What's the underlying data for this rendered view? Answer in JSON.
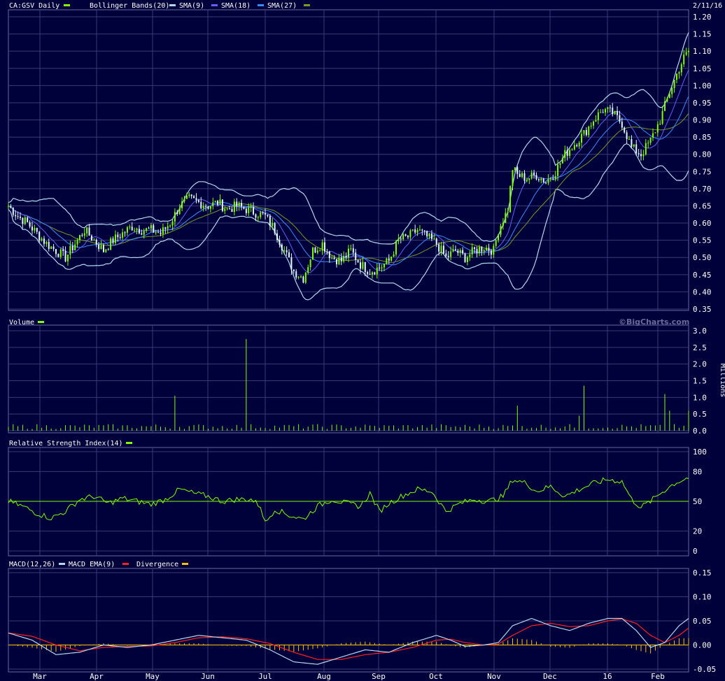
{
  "header": {
    "symbol_label": "CA:GSV Daily",
    "date_label": "2/11/16",
    "watermark": "©BigCharts.com",
    "millions_label": "Millions"
  },
  "legend": {
    "price": [
      {
        "label": "CA:GSV Daily",
        "color": "#7fff00"
      },
      {
        "label": "Bollinger Bands(20)",
        "color": "#b0d8f0"
      },
      {
        "label": "SMA(9)",
        "color": "#6060ff"
      },
      {
        "label": "SMA(18)",
        "color": "#3a8cff"
      },
      {
        "label": "SMA(27)",
        "color": "#7a9a20"
      }
    ],
    "volume": [
      {
        "label": "Volume",
        "color": "#7fff00"
      }
    ],
    "rsi": [
      {
        "label": "Relative Strength Index(14)",
        "color": "#7fff00"
      }
    ],
    "macd": [
      {
        "label": "MACD(12,26)",
        "color": "#b0d8f0"
      },
      {
        "label": "MACD EMA(9)",
        "color": "#ff2020"
      },
      {
        "label": "Divergence",
        "color": "#ffc000"
      }
    ]
  },
  "chart_data": [
    {
      "type": "line",
      "name": "price",
      "x_labels": [
        "Mar",
        "Apr",
        "May",
        "Jun",
        "Jul",
        "Aug",
        "Sep",
        "Oct",
        "Nov",
        "Dec",
        "16",
        "Feb"
      ],
      "ylim": [
        0.35,
        1.2
      ],
      "yticks": [
        "0.35",
        "0.40",
        "0.45",
        "0.50",
        "0.55",
        "0.60",
        "0.65",
        "0.70",
        "0.75",
        "0.80",
        "0.85",
        "0.90",
        "0.95",
        "1.00",
        "1.05",
        "1.10",
        "1.15",
        "1.20"
      ],
      "close_points": [
        [
          0,
          0.65
        ],
        [
          4,
          0.62
        ],
        [
          8,
          0.6
        ],
        [
          12,
          0.57
        ],
        [
          16,
          0.54
        ],
        [
          20,
          0.52
        ],
        [
          24,
          0.5
        ],
        [
          28,
          0.54
        ],
        [
          32,
          0.58
        ],
        [
          36,
          0.55
        ],
        [
          40,
          0.52
        ],
        [
          44,
          0.55
        ],
        [
          48,
          0.57
        ],
        [
          52,
          0.59
        ],
        [
          56,
          0.58
        ],
        [
          60,
          0.58
        ],
        [
          64,
          0.57
        ],
        [
          68,
          0.6
        ],
        [
          72,
          0.65
        ],
        [
          76,
          0.67
        ],
        [
          80,
          0.66
        ],
        [
          84,
          0.65
        ],
        [
          88,
          0.66
        ],
        [
          92,
          0.64
        ],
        [
          96,
          0.65
        ],
        [
          100,
          0.64
        ],
        [
          104,
          0.63
        ],
        [
          108,
          0.62
        ],
        [
          112,
          0.58
        ],
        [
          116,
          0.52
        ],
        [
          120,
          0.46
        ],
        [
          124,
          0.44
        ],
        [
          128,
          0.52
        ],
        [
          132,
          0.54
        ],
        [
          136,
          0.5
        ],
        [
          140,
          0.49
        ],
        [
          144,
          0.52
        ],
        [
          148,
          0.48
        ],
        [
          152,
          0.46
        ],
        [
          156,
          0.47
        ],
        [
          160,
          0.49
        ],
        [
          164,
          0.55
        ],
        [
          168,
          0.56
        ],
        [
          172,
          0.58
        ],
        [
          176,
          0.56
        ],
        [
          180,
          0.54
        ],
        [
          184,
          0.5
        ],
        [
          188,
          0.52
        ],
        [
          192,
          0.5
        ],
        [
          196,
          0.52
        ],
        [
          200,
          0.53
        ],
        [
          204,
          0.52
        ],
        [
          206,
          0.58
        ],
        [
          210,
          0.64
        ],
        [
          212,
          0.76
        ],
        [
          214,
          0.74
        ],
        [
          218,
          0.73
        ],
        [
          222,
          0.74
        ],
        [
          226,
          0.72
        ],
        [
          230,
          0.75
        ],
        [
          234,
          0.8
        ],
        [
          238,
          0.83
        ],
        [
          242,
          0.86
        ],
        [
          246,
          0.9
        ],
        [
          250,
          0.93
        ],
        [
          254,
          0.92
        ],
        [
          258,
          0.89
        ],
        [
          262,
          0.82
        ],
        [
          266,
          0.8
        ],
        [
          270,
          0.84
        ],
        [
          274,
          0.9
        ],
        [
          278,
          0.98
        ],
        [
          282,
          1.05
        ],
        [
          284,
          1.08
        ],
        [
          286,
          1.1
        ]
      ],
      "volume_label": "Volume",
      "volume_unit": "Millions",
      "volume_ylim": [
        0,
        3.0
      ],
      "volume_yticks": [
        "0.0",
        "0.5",
        "1.0",
        "1.5",
        "2.0",
        "2.5",
        "3.0"
      ],
      "volume_spikes": [
        [
          70,
          1.05
        ],
        [
          100,
          2.75
        ],
        [
          215,
          0.75
        ],
        [
          240,
          0.45
        ],
        [
          243,
          1.35
        ],
        [
          276,
          1.1
        ],
        [
          279,
          0.6
        ],
        [
          286,
          0.6
        ]
      ],
      "rsi_ylim": [
        0,
        100
      ],
      "rsi_yticks": [
        "0",
        "20",
        "50",
        "80",
        "100"
      ],
      "rsi_points": [
        [
          0,
          50
        ],
        [
          6,
          45
        ],
        [
          12,
          38
        ],
        [
          18,
          33
        ],
        [
          24,
          40
        ],
        [
          30,
          52
        ],
        [
          36,
          55
        ],
        [
          42,
          48
        ],
        [
          48,
          53
        ],
        [
          54,
          50
        ],
        [
          60,
          47
        ],
        [
          66,
          52
        ],
        [
          72,
          62
        ],
        [
          78,
          58
        ],
        [
          84,
          55
        ],
        [
          90,
          50
        ],
        [
          96,
          52
        ],
        [
          102,
          52
        ],
        [
          106,
          45
        ],
        [
          108,
          28
        ],
        [
          112,
          42
        ],
        [
          118,
          36
        ],
        [
          124,
          32
        ],
        [
          130,
          45
        ],
        [
          136,
          52
        ],
        [
          142,
          48
        ],
        [
          148,
          45
        ],
        [
          152,
          58
        ],
        [
          156,
          40
        ],
        [
          160,
          48
        ],
        [
          166,
          56
        ],
        [
          172,
          62
        ],
        [
          178,
          60
        ],
        [
          184,
          40
        ],
        [
          190,
          48
        ],
        [
          196,
          52
        ],
        [
          202,
          50
        ],
        [
          208,
          55
        ],
        [
          212,
          72
        ],
        [
          218,
          68
        ],
        [
          222,
          60
        ],
        [
          228,
          65
        ],
        [
          234,
          55
        ],
        [
          240,
          62
        ],
        [
          246,
          68
        ],
        [
          252,
          72
        ],
        [
          258,
          70
        ],
        [
          262,
          52
        ],
        [
          266,
          44
        ],
        [
          270,
          50
        ],
        [
          274,
          58
        ],
        [
          280,
          68
        ],
        [
          284,
          72
        ],
        [
          286,
          74
        ]
      ],
      "macd_ylim": [
        -0.05,
        0.15
      ],
      "macd_yticks": [
        "-0.05",
        "0.00",
        "0.05",
        "0.10",
        "0.15"
      ],
      "macd_points": [
        [
          0,
          0.025
        ],
        [
          10,
          0.01
        ],
        [
          20,
          -0.02
        ],
        [
          30,
          -0.015
        ],
        [
          40,
          0.0
        ],
        [
          50,
          -0.005
        ],
        [
          60,
          0.0
        ],
        [
          70,
          0.01
        ],
        [
          80,
          0.02
        ],
        [
          90,
          0.015
        ],
        [
          100,
          0.01
        ],
        [
          110,
          -0.01
        ],
        [
          120,
          -0.035
        ],
        [
          130,
          -0.04
        ],
        [
          140,
          -0.025
        ],
        [
          150,
          -0.01
        ],
        [
          160,
          -0.015
        ],
        [
          170,
          0.005
        ],
        [
          180,
          0.02
        ],
        [
          186,
          0.01
        ],
        [
          192,
          -0.003
        ],
        [
          200,
          0.0
        ],
        [
          206,
          0.005
        ],
        [
          212,
          0.04
        ],
        [
          220,
          0.055
        ],
        [
          228,
          0.04
        ],
        [
          236,
          0.03
        ],
        [
          244,
          0.045
        ],
        [
          252,
          0.055
        ],
        [
          258,
          0.055
        ],
        [
          264,
          0.03
        ],
        [
          270,
          -0.005
        ],
        [
          276,
          0.005
        ],
        [
          282,
          0.04
        ],
        [
          286,
          0.055
        ]
      ],
      "macd_ema_points": [
        [
          0,
          0.025
        ],
        [
          10,
          0.018
        ],
        [
          20,
          0.0
        ],
        [
          30,
          -0.012
        ],
        [
          40,
          -0.005
        ],
        [
          50,
          -0.003
        ],
        [
          60,
          -0.002
        ],
        [
          70,
          0.005
        ],
        [
          80,
          0.015
        ],
        [
          90,
          0.017
        ],
        [
          100,
          0.013
        ],
        [
          110,
          0.003
        ],
        [
          120,
          -0.015
        ],
        [
          130,
          -0.03
        ],
        [
          140,
          -0.03
        ],
        [
          150,
          -0.02
        ],
        [
          160,
          -0.015
        ],
        [
          170,
          -0.005
        ],
        [
          180,
          0.01
        ],
        [
          186,
          0.012
        ],
        [
          192,
          0.005
        ],
        [
          200,
          0.0
        ],
        [
          206,
          0.002
        ],
        [
          212,
          0.02
        ],
        [
          220,
          0.04
        ],
        [
          228,
          0.045
        ],
        [
          236,
          0.038
        ],
        [
          244,
          0.04
        ],
        [
          252,
          0.05
        ],
        [
          258,
          0.054
        ],
        [
          264,
          0.045
        ],
        [
          270,
          0.02
        ],
        [
          276,
          0.005
        ],
        [
          282,
          0.02
        ],
        [
          286,
          0.035
        ]
      ]
    }
  ]
}
